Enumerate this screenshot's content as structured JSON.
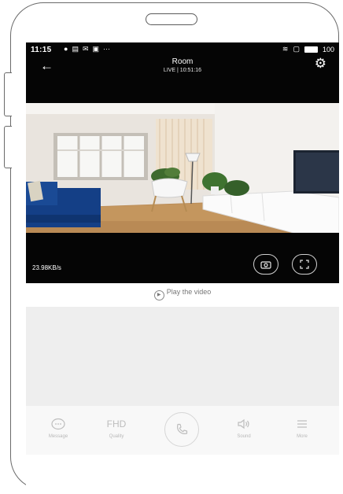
{
  "status_bar": {
    "time": "11:15",
    "left_icons": [
      "chat-icon",
      "grid-icon",
      "mail-icon",
      "image-icon",
      "more-dots-icon"
    ],
    "right_icons": [
      "wifi-icon",
      "sim-icon",
      "battery-icon"
    ],
    "battery": "100"
  },
  "header": {
    "title": "Room",
    "subtitle": "LIVE | 10:51:16"
  },
  "video": {
    "speed": "23.98KB/s"
  },
  "play_video": {
    "label": "Play the video"
  },
  "toolbar": {
    "items": [
      {
        "label": "Message",
        "icon": "message-icon"
      },
      {
        "label": "FHD",
        "sub": "Quality",
        "icon": "quality-text"
      },
      {
        "label": "",
        "icon": "phone-call-icon"
      },
      {
        "label": "Sound",
        "icon": "speaker-icon"
      },
      {
        "label": "More",
        "icon": "menu-icon"
      }
    ]
  },
  "colors": {
    "bar_background": "#050505",
    "panel_gray": "#eeeeee",
    "toolbar_bg": "#f8f8f8"
  }
}
